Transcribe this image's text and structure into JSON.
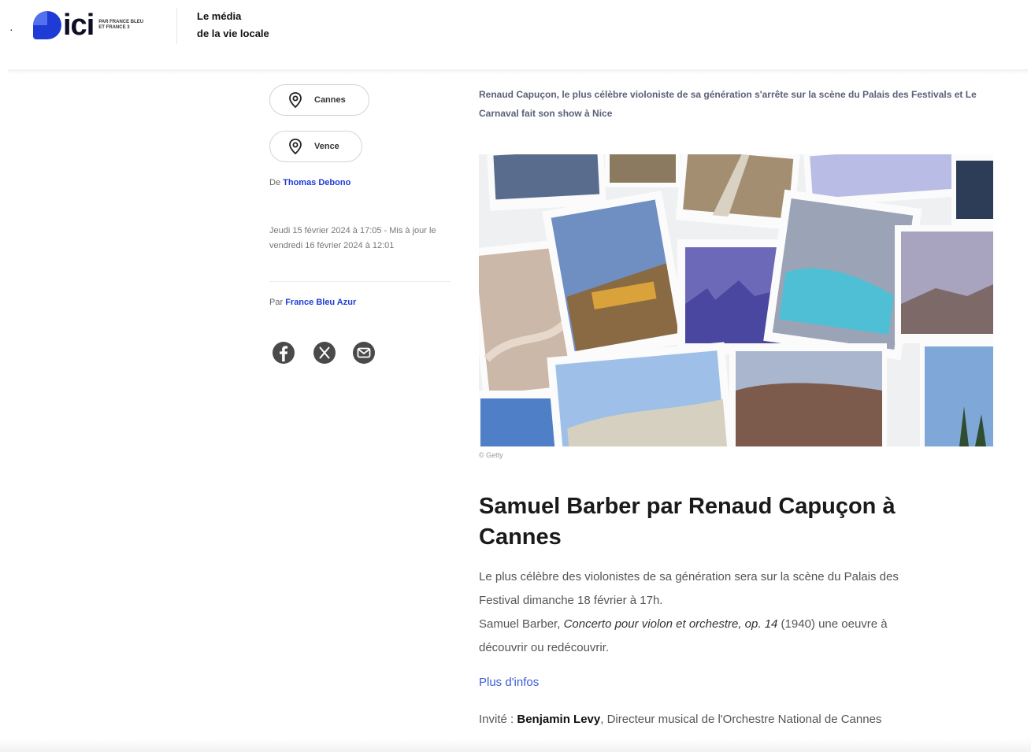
{
  "header": {
    "bullet": "·",
    "logo_text": "ici",
    "logo_sub": "PAR FRANCE BLEU ET FRANCE 3",
    "tagline_line1": "Le média",
    "tagline_line2": "de la vie locale",
    "brand_color": "#1f3bd6"
  },
  "sidebar": {
    "tags": [
      {
        "label": "Cannes",
        "icon": "map-pin-icon"
      },
      {
        "label": "Vence",
        "icon": "map-pin-icon"
      }
    ],
    "byline_prefix": "De",
    "author": "Thomas Debono",
    "dates": "Jeudi 15 février 2024 à 17:05 - Mis à jour le vendredi 16 février 2024 à 12:01",
    "per_prefix": "Par",
    "source": "France Bleu Azur",
    "share_icons": [
      "facebook-icon",
      "x-icon",
      "mail-icon"
    ]
  },
  "article": {
    "lead": "Renaud Capuçon, le plus célèbre violoniste de sa génération s'arrête sur la scène du Palais des Festivals et Le Carnaval fait son show à Nice",
    "image_credit": "© Getty",
    "title": "Samuel Barber par Renaud Capuçon à Cannes",
    "p1_line1": "Le plus célèbre des violonistes de sa génération sera sur la scène du Palais des",
    "p1_line2": "Festival dimanche 18 février à 17h.",
    "p2_start": "Samuel Barber, ",
    "p2_italic": "Concerto pour violon et orchestre, op. 14",
    "p2_end": " (1940) une oeuvre à",
    "p2_line2": "découvrir ou redécouvrir.",
    "more_link": "Plus d'infos",
    "guest_label": "Invité : ",
    "guest_name": "Benjamin Levy",
    "guest_role": ", Directeur musical de l'Orchestre National de Cannes"
  }
}
